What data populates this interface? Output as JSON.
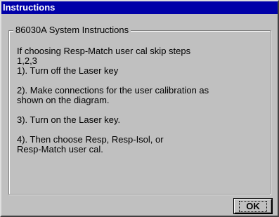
{
  "window": {
    "title": "Instructions"
  },
  "group": {
    "label": "86030A System Instructions"
  },
  "instructions": {
    "intro": "If choosing Resp-Match user cal skip steps\n1,2,3",
    "step1": "1). Turn off the Laser key",
    "step2": "2). Make connections for the user calibration as\nshown on the diagram.",
    "step3": "3). Turn on the Laser key.",
    "step4": "4). Then choose Resp, Resp-Isol, or\nResp-Match user cal."
  },
  "buttons": {
    "ok_label": "OK"
  },
  "colors": {
    "titlebar": "#0000a8",
    "window_face": "#c0c0c0"
  }
}
